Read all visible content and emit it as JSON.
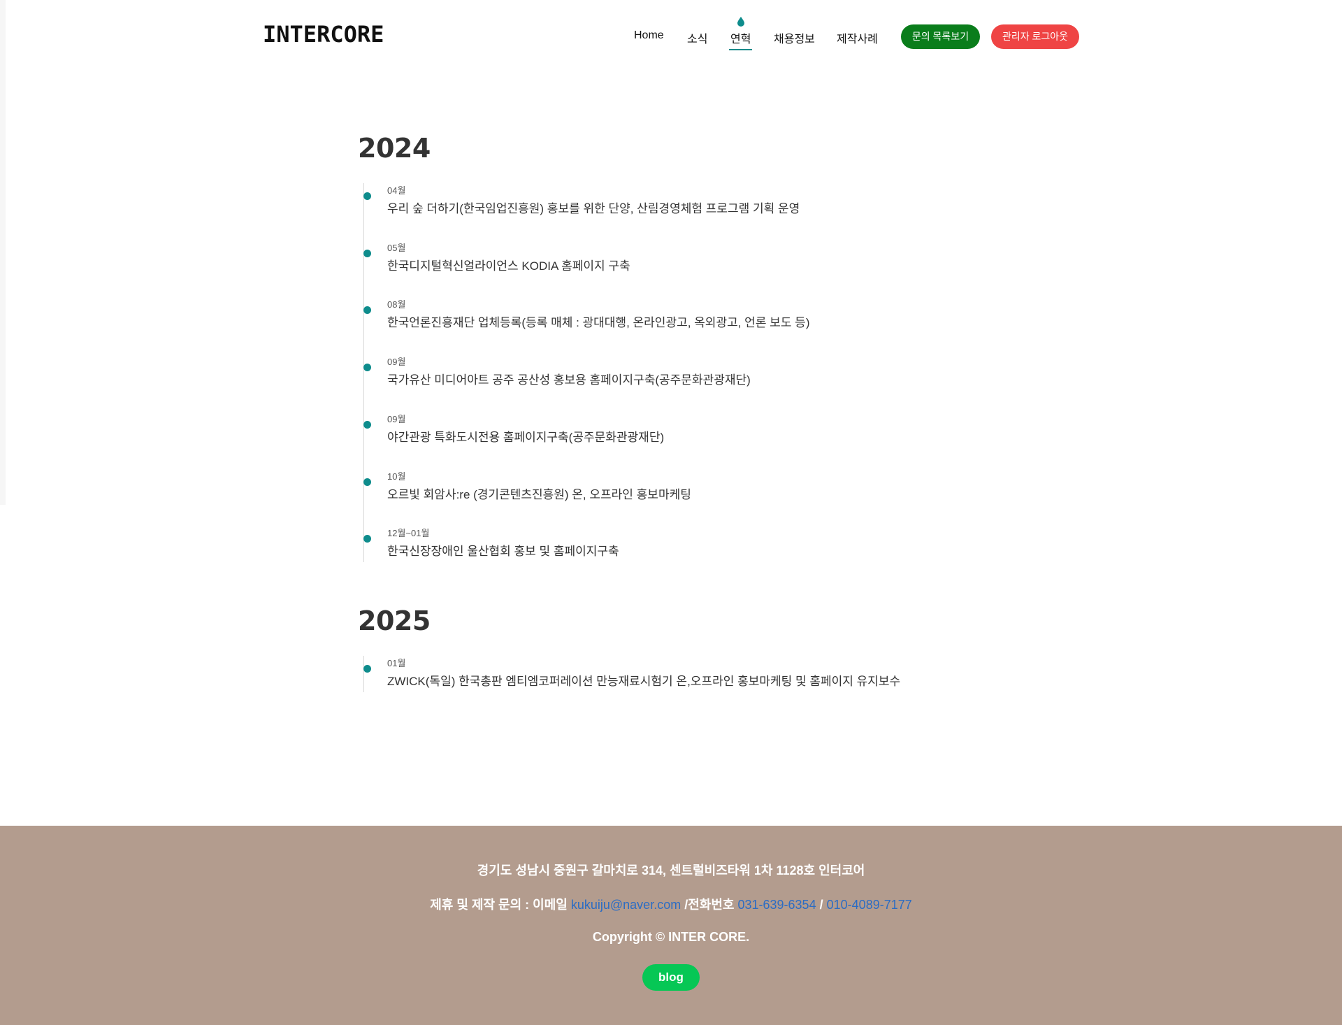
{
  "header": {
    "logo": "INTERCORE",
    "nav": [
      {
        "label": "Home"
      },
      {
        "label": "소식"
      },
      {
        "label": "연혁"
      },
      {
        "label": "채용정보"
      },
      {
        "label": "제작사례"
      }
    ],
    "active_nav": "연혁",
    "inquiry_button": "문의 목록보기",
    "admin_button": "관리자 로그아웃"
  },
  "history": [
    {
      "year": "2024",
      "items": [
        {
          "month": "04월",
          "text": "우리 숲 더하기(한국임업진흥원) 홍보를 위한 단양, 산림경영체험 프로그램 기획 운영"
        },
        {
          "month": "05월",
          "text": "한국디지털혁신얼라이언스 KODIA 홈페이지 구축"
        },
        {
          "month": "08월",
          "text": "한국언론진흥재단 업체등록(등록 매체 : 광대대행, 온라인광고, 옥외광고, 언론 보도 등)"
        },
        {
          "month": "09월",
          "text": "국가유산 미디어아트 공주 공산성 홍보용 홈페이지구축(공주문화관광재단)"
        },
        {
          "month": "09월",
          "text": "야간관광 특화도시전용 홈페이지구축(공주문화관광재단)"
        },
        {
          "month": "10월",
          "text": "오르빛 회암사:re (경기콘텐츠진흥원) 온, 오프라인 홍보마케팅"
        },
        {
          "month": "12월~01월",
          "text": "한국신장장애인 울산협회 홍보 및 홈페이지구축"
        }
      ]
    },
    {
      "year": "2025",
      "items": [
        {
          "month": "01월",
          "text": "ZWICK(독일) 한국총판 엠티엠코퍼레이션 만능재료시험기 온,오프라인 홍보마케팅 및 홈페이지 유지보수"
        }
      ]
    }
  ],
  "footer": {
    "address": "경기도 성남시 중원구 갈마치로 314, 센트럴비즈타워 1차 1128호 인터코어",
    "contact_prefix": "제휴 및 제작 문의 : 이메일",
    "email": "kukuiju@naver.com",
    "phone_label": "/전화번호",
    "phone1": "031-639-6354",
    "separator": "/",
    "phone2": "010-4089-7177",
    "copyright": "Copyright © INTER CORE.",
    "blog_button": "blog"
  },
  "colors": {
    "accent_teal": "#0e8c8c",
    "inquiry_green": "#0a7d1b",
    "admin_red": "#ef4444",
    "footer_bg": "#b39c8e",
    "blog_green": "#06c755",
    "link_blue": "#2b6cc4"
  }
}
